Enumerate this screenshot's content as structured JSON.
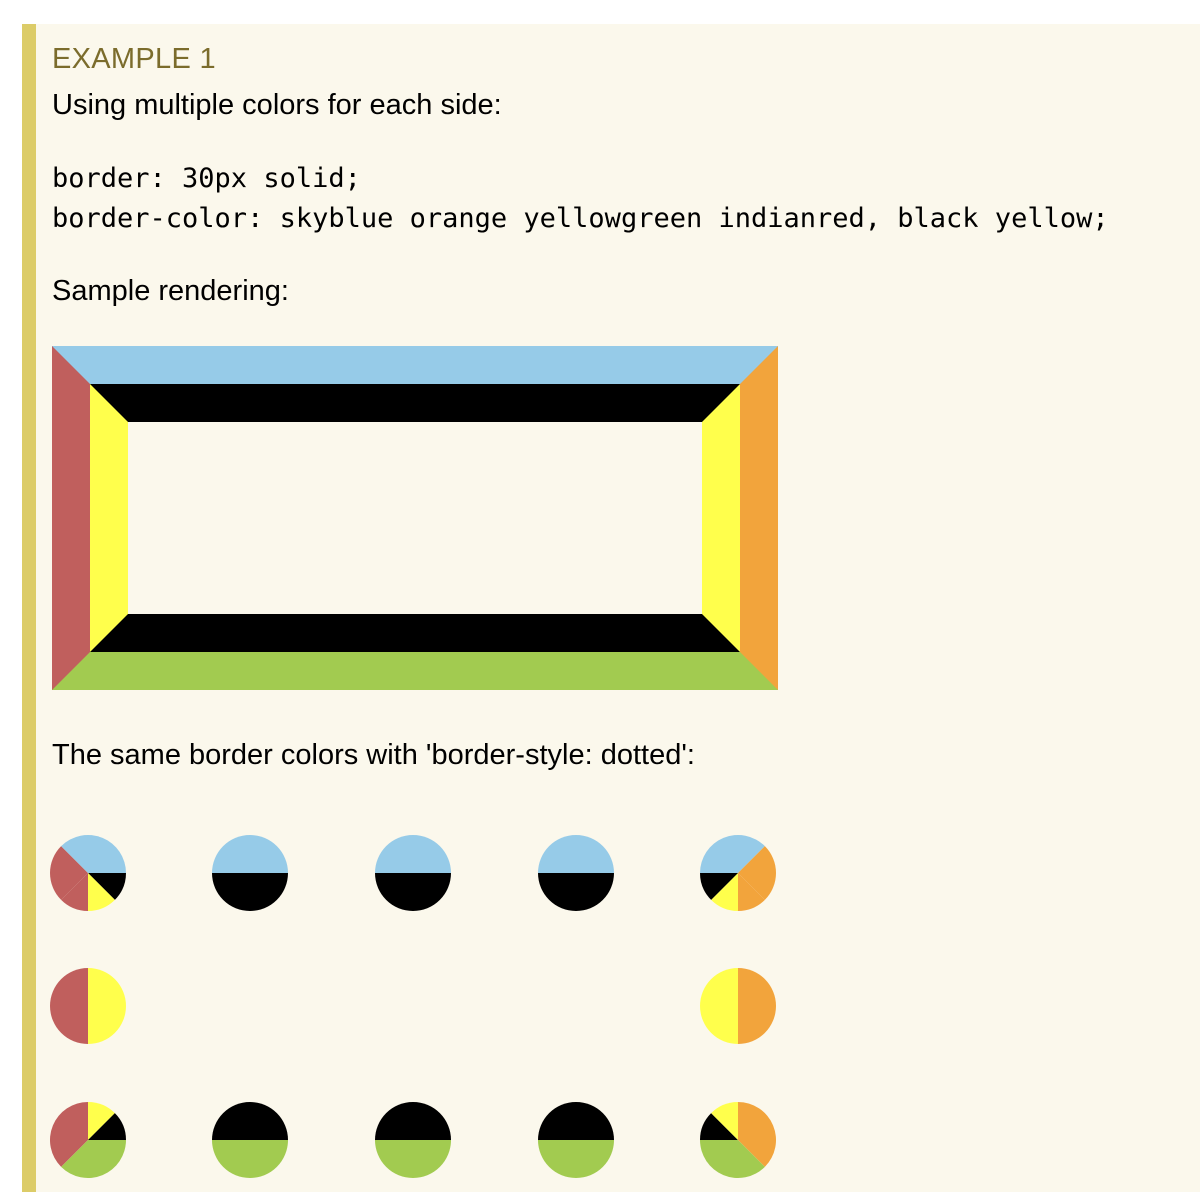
{
  "example": {
    "label": "EXAMPLE 1",
    "intro": "Using multiple colors for each side:",
    "code_lines": [
      "border: 30px solid;",
      "border-color: skyblue orange yellowgreen indianred, black yellow;"
    ],
    "sample_heading": "Sample rendering:",
    "dotted_heading": "The same border colors with 'border-style: dotted':"
  },
  "colors": {
    "skyblue": "#96cbe8",
    "orange": "#f2a43c",
    "yellowgreen": "#a2cb50",
    "indianred": "#c05f5d",
    "black": "#000000",
    "yellow": "#ffff4c",
    "panel_bg": "#fbf8ec",
    "panel_border": "#dccc68",
    "label_color": "#7b6c2c"
  }
}
